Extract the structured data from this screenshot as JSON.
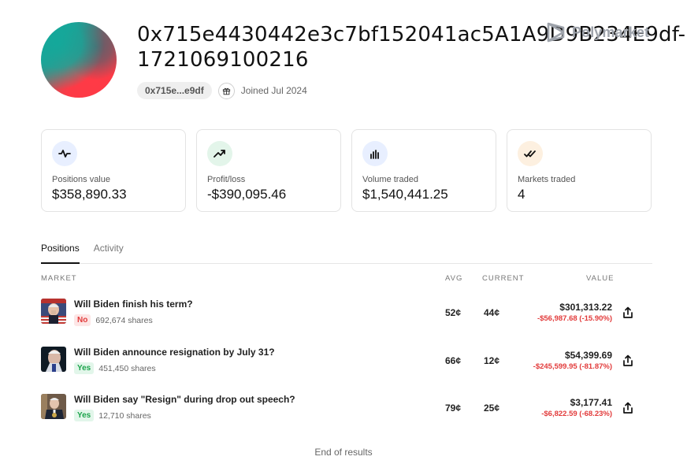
{
  "profile": {
    "title": "0x715e4430442e3c7bf152041ac5A1A9D9B234E9df-1721069100216",
    "address_short": "0x715e...e9df",
    "joined": "Joined Jul 2024"
  },
  "brand": {
    "name": "Polymarket"
  },
  "stats": [
    {
      "label": "Positions value",
      "value": "$358,890.33",
      "icon": "pulse-icon",
      "color": "#e8efff"
    },
    {
      "label": "Profit/loss",
      "value": "-$390,095.46",
      "icon": "trend-up-icon",
      "color": "#e3f5ea"
    },
    {
      "label": "Volume traded",
      "value": "$1,540,441.25",
      "icon": "bar-chart-icon",
      "color": "#e8efff"
    },
    {
      "label": "Markets traded",
      "value": "4",
      "icon": "check-double-icon",
      "color": "#fdf0e0"
    }
  ],
  "tabs": [
    {
      "label": "Positions",
      "active": true
    },
    {
      "label": "Activity",
      "active": false
    }
  ],
  "table": {
    "headers": {
      "market": "MARKET",
      "avg": "AVG",
      "current": "CURRENT",
      "value": "VALUE"
    },
    "rows": [
      {
        "question": "Will Biden finish his term?",
        "outcome": "No",
        "shares": "692,674 shares",
        "avg": "52¢",
        "current": "44¢",
        "value": "$301,313.22",
        "change": "-$56,987.68 (-15.90%)"
      },
      {
        "question": "Will Biden announce resignation by July 31?",
        "outcome": "Yes",
        "shares": "451,450 shares",
        "avg": "66¢",
        "current": "12¢",
        "value": "$54,399.69",
        "change": "-$245,599.95 (-81.87%)"
      },
      {
        "question": "Will Biden say \"Resign\" during drop out speech?",
        "outcome": "Yes",
        "shares": "12,710 shares",
        "avg": "79¢",
        "current": "25¢",
        "value": "$3,177.41",
        "change": "-$6,822.59 (-68.23%)"
      }
    ]
  },
  "footer": {
    "end_text": "End of results"
  }
}
